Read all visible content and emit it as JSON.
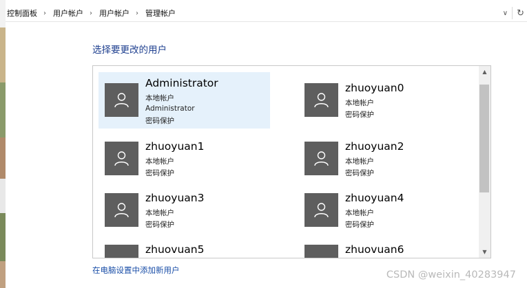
{
  "breadcrumbs": [
    "控制面板",
    "用户帐户",
    "用户帐户",
    "管理帐户"
  ],
  "address_icons": {
    "dropdown": "chevron-down-icon",
    "refresh": "refresh-icon"
  },
  "heading": "选择要更改的用户",
  "accounts": [
    {
      "name": "Administrator",
      "type": "本地帐户",
      "extra": "Administrator",
      "security": "密码保护",
      "selected": true
    },
    {
      "name": "zhuoyuan0",
      "type": "本地帐户",
      "security": "密码保护"
    },
    {
      "name": "zhuoyuan1",
      "type": "本地帐户",
      "security": "密码保护"
    },
    {
      "name": "zhuoyuan2",
      "type": "本地帐户",
      "security": "密码保护"
    },
    {
      "name": "zhuoyuan3",
      "type": "本地帐户",
      "security": "密码保护"
    },
    {
      "name": "zhuoyuan4",
      "type": "本地帐户",
      "security": "密码保护"
    },
    {
      "name": "zhuovuan5"
    },
    {
      "name": "zhuovuan6"
    }
  ],
  "add_user_link": "在电脑设置中添加新用户",
  "watermark": "CSDN @weixin_40283947",
  "colors": {
    "heading": "#1e3f8f",
    "link": "#1b4fa8",
    "selected_tile": "#e5f1fb",
    "avatar": "#5e5e5e"
  }
}
